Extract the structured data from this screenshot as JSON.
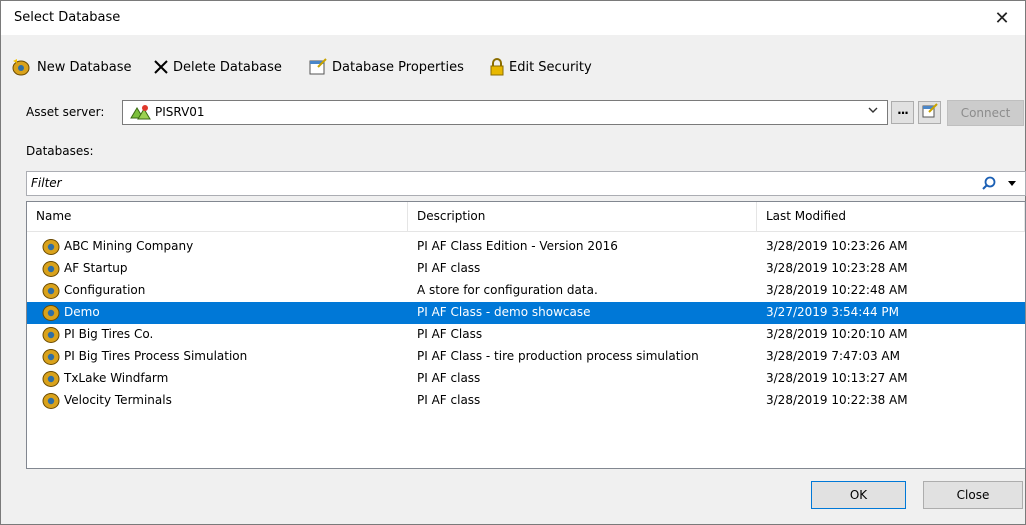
{
  "window": {
    "title": "Select Database",
    "close_glyph": "✕"
  },
  "toolbar": {
    "new_db_label": "New Database",
    "delete_db_label": "Delete Database",
    "db_props_label": "Database Properties",
    "edit_security_label": "Edit Security"
  },
  "asset_server": {
    "label": "Asset server:",
    "value": "PISRV01",
    "dots_label": "···",
    "connect_label": "Connect"
  },
  "databases": {
    "label": "Databases:",
    "filter_placeholder": "Filter"
  },
  "table": {
    "headers": [
      "Name",
      "Description",
      "Last Modified"
    ],
    "rows": [
      {
        "name": "ABC Mining Company",
        "description": "PI AF Class Edition - Version 2016",
        "modified": "3/28/2019 10:23:26 AM"
      },
      {
        "name": "AF Startup",
        "description": "PI AF class",
        "modified": "3/28/2019 10:23:28 AM"
      },
      {
        "name": "Configuration",
        "description": "A store for configuration data.",
        "modified": "3/28/2019 10:22:48 AM"
      },
      {
        "name": "Demo",
        "description": "PI AF Class - demo showcase",
        "modified": "3/27/2019 3:54:44 PM",
        "selected": true
      },
      {
        "name": "PI Big Tires Co.",
        "description": "PI AF Class",
        "modified": "3/28/2019 10:20:10 AM"
      },
      {
        "name": "PI Big Tires Process Simulation",
        "description": "PI AF Class - tire production process simulation",
        "modified": "3/28/2019 7:47:03 AM"
      },
      {
        "name": "TxLake Windfarm",
        "description": "PI AF class",
        "modified": "3/28/2019 10:13:27 AM"
      },
      {
        "name": "Velocity Terminals",
        "description": "PI AF class",
        "modified": "3/28/2019 10:22:38 AM"
      }
    ]
  },
  "footer": {
    "ok_label": "OK",
    "close_label": "Close"
  },
  "colors": {
    "selection": "#0078d7",
    "db_icon": "#d9a21b"
  }
}
